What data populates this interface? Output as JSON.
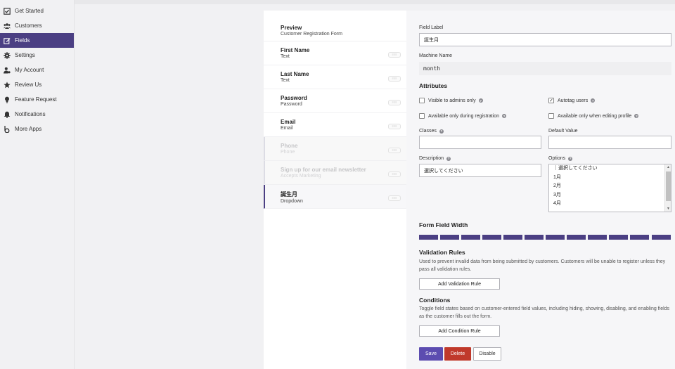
{
  "sidebar": {
    "items": [
      {
        "label": "Get Started",
        "icon": "check-square-icon"
      },
      {
        "label": "Customers",
        "icon": "users-icon"
      },
      {
        "label": "Fields",
        "icon": "edit-icon",
        "active": true
      },
      {
        "label": "Settings",
        "icon": "gear-icon"
      },
      {
        "label": "My Account",
        "icon": "user-gear-icon"
      },
      {
        "label": "Review Us",
        "icon": "star-icon"
      },
      {
        "label": "Feature Request",
        "icon": "lightbulb-icon"
      },
      {
        "label": "Notifications",
        "icon": "bell-icon"
      },
      {
        "label": "More Apps",
        "icon": "b-logo-icon"
      }
    ]
  },
  "fields_list": {
    "preview": {
      "title": "Preview",
      "subtitle": "Customer Registration Form"
    },
    "items": [
      {
        "title": "First Name",
        "type": "Text"
      },
      {
        "title": "Last Name",
        "type": "Text"
      },
      {
        "title": "Password",
        "type": "Password"
      },
      {
        "title": "Email",
        "type": "Email"
      },
      {
        "title": "Phone",
        "type": "Phone"
      },
      {
        "title": "Sign up for our email newsletter",
        "type": "Accepts Marketing"
      },
      {
        "title": "誕生月",
        "type": "Dropdown"
      }
    ]
  },
  "editor": {
    "field_label": {
      "label": "Field Label",
      "value": "誕生月"
    },
    "machine_name": {
      "label": "Machine Name",
      "value": "month"
    },
    "attributes": {
      "heading": "Attributes",
      "checkboxes": [
        {
          "label": "Visible to admins only",
          "checked": false
        },
        {
          "label": "Autotag users",
          "checked": true
        },
        {
          "label": "Available only during registration",
          "checked": false
        },
        {
          "label": "Available only when editing profile",
          "checked": false
        }
      ]
    },
    "classes": {
      "label": "Classes",
      "value": ""
    },
    "default_value": {
      "label": "Default Value",
      "value": ""
    },
    "description": {
      "label": "Description",
      "value": "選択してください"
    },
    "options": {
      "label": "Options",
      "lines": [
        "｜選択してください",
        "1月",
        "2月",
        "3月",
        "4月"
      ]
    },
    "form_field_width": {
      "heading": "Form Field Width",
      "segments": 12,
      "filled": 12
    },
    "validation": {
      "heading": "Validation Rules",
      "text": "Used to prevent invalid data from being submitted by customers. Customers will be unable to register unless they pass all validation rules.",
      "button": "Add Validation Rule"
    },
    "conditions": {
      "heading": "Conditions",
      "text": "Toggle field states based on customer-entered field values, including hiding, showing, disabling, and enabling fields as the customer fills out the form.",
      "button": "Add Condition Rule"
    },
    "actions": {
      "save": "Save",
      "delete": "Delete",
      "disable": "Disable"
    }
  },
  "colors": {
    "accent": "#4b3f83",
    "danger": "#c0392b",
    "save": "#5c4cb0"
  }
}
